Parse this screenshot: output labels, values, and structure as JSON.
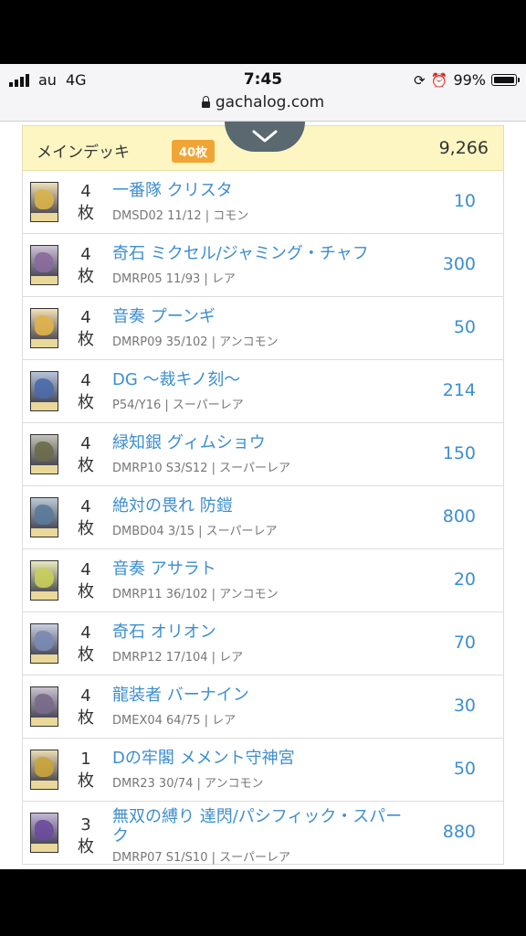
{
  "status_bar": {
    "carrier": "au",
    "network": "4G",
    "time": "7:45",
    "battery_percent": "99%",
    "battery_level": 0.99,
    "icons": [
      "signal-bars-icon",
      "rotation-lock-icon",
      "alarm-icon",
      "battery-icon"
    ]
  },
  "browser": {
    "url": "gachalog.com",
    "lock_icon": "lock-icon"
  },
  "deck": {
    "title": "メインデッキ",
    "count_badge": "40枚",
    "total": "9,266",
    "collapse_icon": "chevron-down-icon"
  },
  "colors": {
    "link": "#3d8ed1",
    "header_bg": "#fdf6c3",
    "badge": "#f0a534",
    "tab": "#5a6870"
  },
  "cards": [
    {
      "qty": "4",
      "unit": "枚",
      "name": "一番隊 クリスタ",
      "meta": "DMSD02 11/12 | コモン",
      "price": "10",
      "art": "#d9b24a"
    },
    {
      "qty": "4",
      "unit": "枚",
      "name": "奇石 ミクセル/ジャミング・チャフ",
      "meta": "DMRP05 11/93 | レア",
      "price": "300",
      "art": "#8a6a9c"
    },
    {
      "qty": "4",
      "unit": "枚",
      "name": "音奏 プーンギ",
      "meta": "DMRP09 35/102 | アンコモン",
      "price": "50",
      "art": "#e0b34a"
    },
    {
      "qty": "4",
      "unit": "枚",
      "name": "DG 〜裁キノ刻〜",
      "meta": "P54/Y16 | スーパーレア",
      "price": "214",
      "art": "#4a6aa8"
    },
    {
      "qty": "4",
      "unit": "枚",
      "name": "緑知銀 グィムショウ",
      "meta": "DMRP10 S3/S12 | スーパーレア",
      "price": "150",
      "art": "#6a6a4a"
    },
    {
      "qty": "4",
      "unit": "枚",
      "name": "絶対の畏れ 防鎧",
      "meta": "DMBD04 3/15 | スーパーレア",
      "price": "800",
      "art": "#5a7a9a"
    },
    {
      "qty": "4",
      "unit": "枚",
      "name": "音奏 アサラト",
      "meta": "DMRP11 36/102 | アンコモン",
      "price": "20",
      "art": "#c9cf5a"
    },
    {
      "qty": "4",
      "unit": "枚",
      "name": "奇石 オリオン",
      "meta": "DMRP12 17/104 | レア",
      "price": "70",
      "art": "#7a8ab4"
    },
    {
      "qty": "4",
      "unit": "枚",
      "name": "龍装者 バーナイン",
      "meta": "DMEX04 64/75 | レア",
      "price": "30",
      "art": "#7a6a8a"
    },
    {
      "qty": "1",
      "unit": "枚",
      "name": "Dの牢閣 メメント守神宮",
      "meta": "DMR23 30/74 | アンコモン",
      "price": "50",
      "art": "#c9a43a"
    },
    {
      "qty": "3",
      "unit": "枚",
      "name": "無双の縛り 達閃/パシフィック・スパーク",
      "meta": "DMRP07 S1/S10 | スーパーレア",
      "price": "880",
      "art": "#6a4a9c"
    }
  ]
}
